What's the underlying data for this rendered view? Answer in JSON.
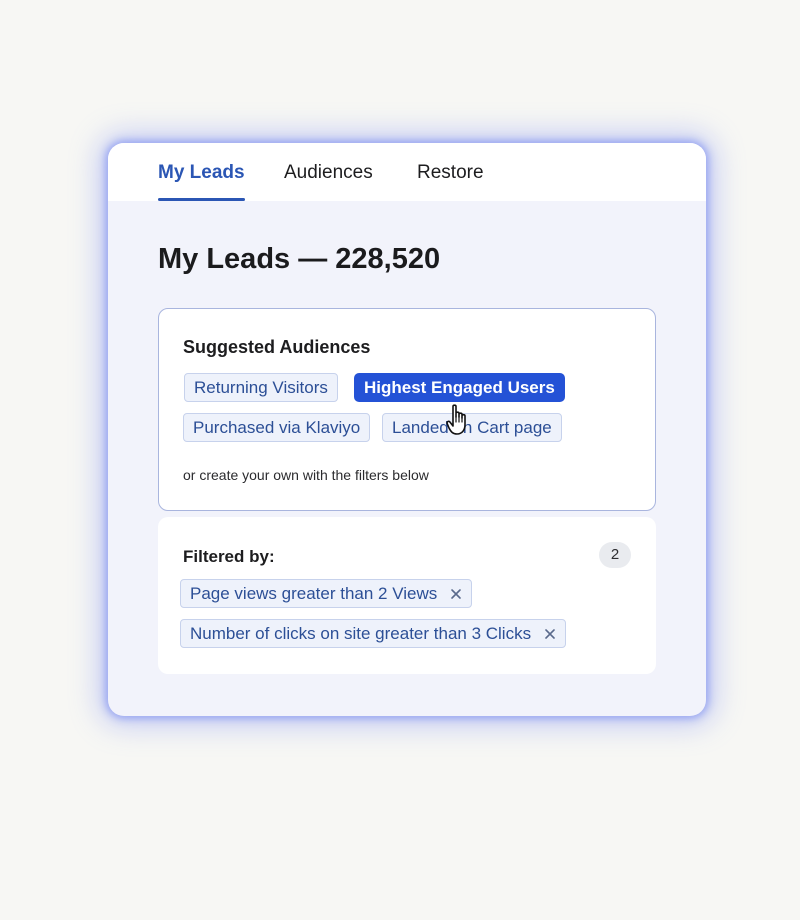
{
  "tabs": [
    {
      "label": "My Leads",
      "active": true
    },
    {
      "label": "Audiences",
      "active": false
    },
    {
      "label": "Restore",
      "active": false
    }
  ],
  "page": {
    "title": "My Leads — 228,520"
  },
  "suggested": {
    "heading": "Suggested Audiences",
    "chips": [
      {
        "label": "Returning Visitors",
        "selected": false
      },
      {
        "label": "Highest Engaged Users",
        "selected": true
      },
      {
        "label": "Purchased via Klaviyo",
        "selected": false
      },
      {
        "label": "Landed on Cart page",
        "selected": false
      }
    ],
    "hint": "or create your own with the filters below"
  },
  "filters": {
    "heading": "Filtered by:",
    "count": "2",
    "items": [
      {
        "label": "Page views greater than 2 Views",
        "remove_icon": "close-icon"
      },
      {
        "label": "Number of clicks on site greater than 3 Clicks",
        "remove_icon": "close-icon"
      }
    ]
  },
  "colors": {
    "accent": "#2b56b4",
    "selected_chip": "#2452d6",
    "chip_text": "#2c4f96",
    "card_bg": "#f2f3fb",
    "glow": "#6e82f0"
  },
  "icons": {
    "cursor": "hand-pointer-icon"
  }
}
